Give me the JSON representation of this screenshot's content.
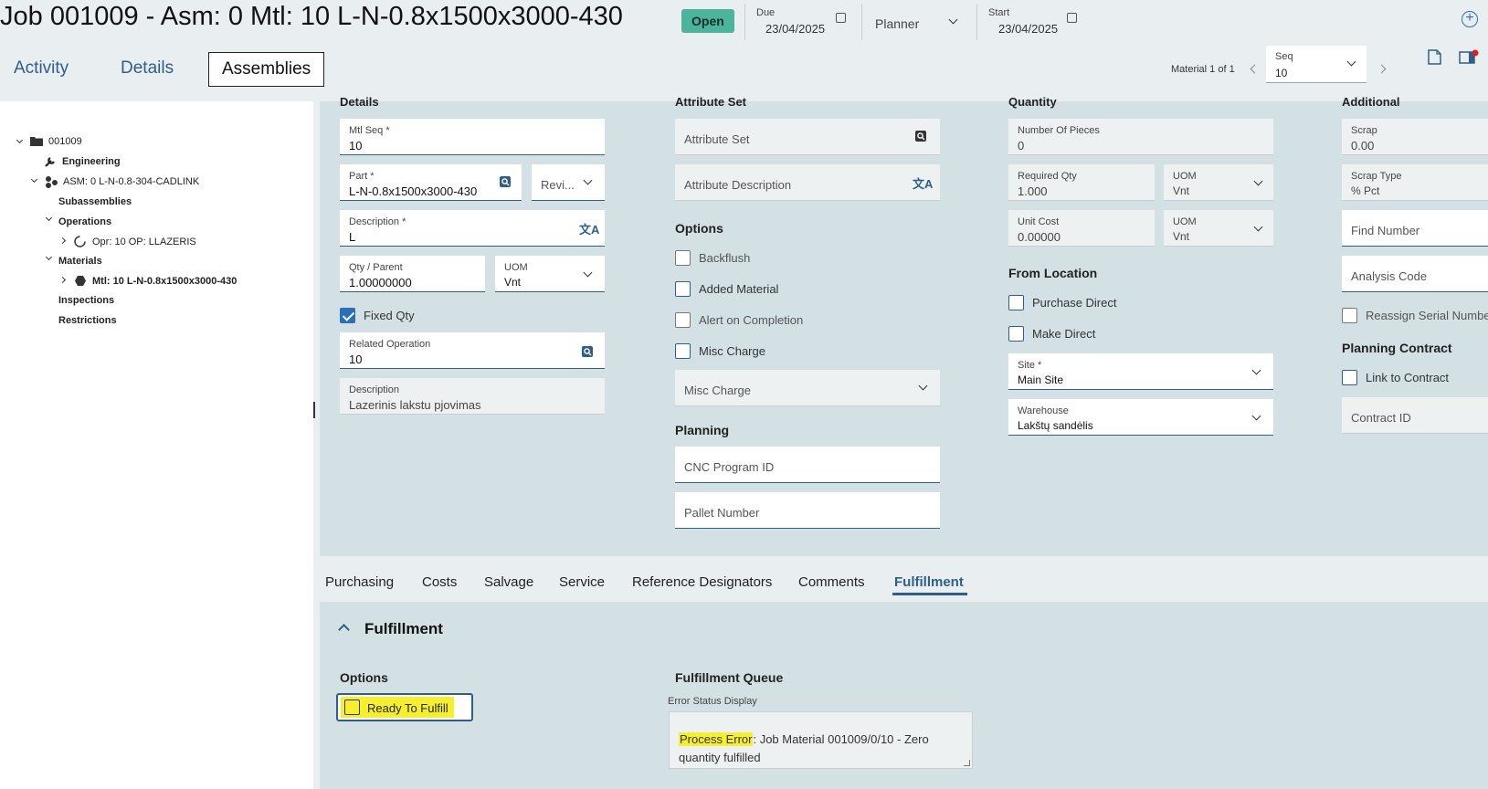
{
  "header": {
    "title": "Job 001009 - Asm: 0 Mtl: 10 L-N-0.8x1500x3000-430",
    "status": "Open",
    "due_label": "Due",
    "due_value": "23/04/2025",
    "planner_value": "Planner",
    "start_label": "Start",
    "start_value": "23/04/2025"
  },
  "tabs": [
    "Activity",
    "Details",
    "Assemblies"
  ],
  "material_nav": {
    "text": "Material 1 of 1",
    "seq_label": "Seq",
    "seq_value": "10"
  },
  "tree": {
    "root": "001009",
    "engineering": "Engineering",
    "asm": "ASM: 0 L-N-0.8-304-CADLINK",
    "subassemblies": "Subassemblies",
    "operations": "Operations",
    "opr": "Opr: 10 OP: LLAZERIS",
    "materials": "Materials",
    "mtl": "Mtl: 10 L-N-0.8x1500x3000-430",
    "inspections": "Inspections",
    "restrictions": "Restrictions"
  },
  "details": {
    "heading": "Details",
    "mtl_seq_label": "Mtl Seq *",
    "mtl_seq_value": "10",
    "part_label": "Part *",
    "part_value": "L-N-0.8x1500x3000-430",
    "revision_placeholder": "Revi...",
    "description_label": "Description *",
    "description_value": "L",
    "qty_label": "Qty / Parent",
    "qty_value": "1.00000000",
    "uom_label": "UOM",
    "uom_value": "Vnt",
    "fixed_qty_label": "Fixed Qty",
    "related_op_label": "Related Operation",
    "related_op_value": "10",
    "op_desc_label": "Description",
    "op_desc_value": "Lazerinis lakstu pjovimas"
  },
  "attribute": {
    "heading": "Attribute Set",
    "attr_set_placeholder": "Attribute Set",
    "attr_desc_placeholder": "Attribute Description",
    "options_heading": "Options",
    "backflush": "Backflush",
    "added_material": "Added Material",
    "alert_on_completion": "Alert on Completion",
    "misc_charge": "Misc Charge",
    "misc_charge_select": "Misc Charge",
    "planning_heading": "Planning",
    "cnc_placeholder": "CNC Program ID",
    "pallet_placeholder": "Pallet Number"
  },
  "quantity": {
    "heading": "Quantity",
    "pieces_label": "Number Of Pieces",
    "pieces_value": "0",
    "req_qty_label": "Required Qty",
    "req_qty_value": "1.000",
    "uom1_label": "UOM",
    "uom1_value": "Vnt",
    "unit_cost_label": "Unit Cost",
    "unit_cost_value": "0.00000",
    "uom2_label": "UOM",
    "uom2_value": "Vnt",
    "from_location_heading": "From Location",
    "purchase_direct": "Purchase Direct",
    "make_direct": "Make Direct",
    "site_label": "Site *",
    "site_value": "Main Site",
    "warehouse_label": "Warehouse",
    "warehouse_value": "Lakštų sandėlis"
  },
  "additional": {
    "heading": "Additional",
    "scrap_label": "Scrap",
    "scrap_value": "0.00",
    "scrap_type_label": "Scrap Type",
    "scrap_type_value": "% Pct",
    "find_number_placeholder": "Find Number",
    "analysis_code_placeholder": "Analysis Code",
    "reassign_serial": "Reassign Serial Numbe",
    "planning_contract_heading": "Planning Contract",
    "link_to_contract": "Link to Contract",
    "contract_id_placeholder": "Contract ID"
  },
  "lower_tabs": [
    "Purchasing",
    "Costs",
    "Salvage",
    "Service",
    "Reference Designators",
    "Comments",
    "Fulfillment"
  ],
  "fulfillment": {
    "title": "Fulfillment",
    "options_heading": "Options",
    "ready_to_fulfill": "Ready To Fulfill",
    "queue_heading": "Fulfillment Queue",
    "error_label": "Error Status Display",
    "error_prefix": "Process Error",
    "error_rest": ": Job Material 001009/0/10 - Zero quantity fulfilled"
  },
  "colors": {
    "accent": "#2d5f8a",
    "status_open": "#4bb49b",
    "highlight": "#f6ef2c"
  }
}
